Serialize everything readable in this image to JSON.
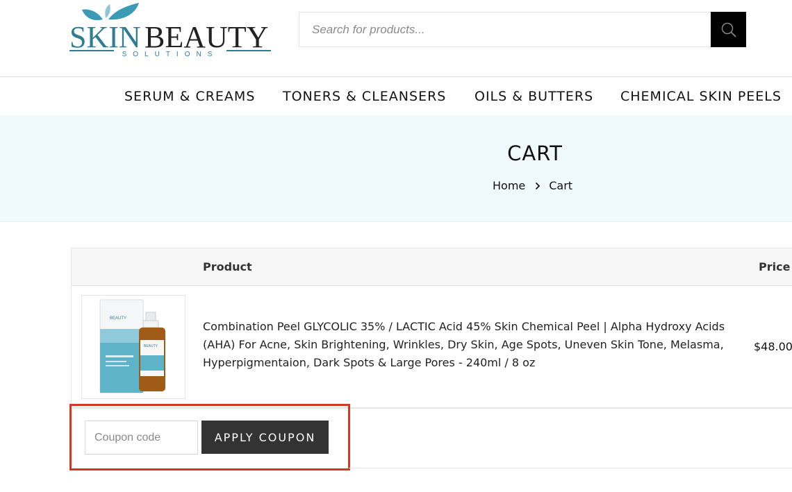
{
  "header": {
    "logo": {
      "word_skin": "SKIN",
      "word_beauty": "BEAUTY",
      "tagline": "SOLUTIONS",
      "colors": {
        "skin": "#2f7c95",
        "beauty": "#222222",
        "leaf": "#3a9bb5"
      }
    },
    "search": {
      "placeholder": "Search for products...",
      "button_icon": "search-icon"
    }
  },
  "nav": {
    "items": [
      {
        "label": "SERUM & CREAMS"
      },
      {
        "label": "TONERS & CLEANSERS"
      },
      {
        "label": "OILS & BUTTERS"
      },
      {
        "label": "CHEMICAL SKIN PEELS"
      }
    ]
  },
  "banner": {
    "title": "CART",
    "breadcrumb": {
      "home": "Home",
      "current": "Cart",
      "separator_icon": "chevron-right-icon"
    },
    "background": "#f0fafd"
  },
  "cart": {
    "columns": {
      "product": "Product",
      "price": "Price"
    },
    "items": [
      {
        "name": "Combination Peel GLYCOLIC 35% / LACTIC Acid 45% Skin Chemical Peel | Alpha Hydroxy Acids (AHA) For Acne, Skin Brightening, Wrinkles, Dry Skin, Age Spots, Uneven Skin Tone, Melasma, Hyperpigmentaion, Dark Spots & Large Pores - 240ml / 8 oz",
        "price": "$48.00",
        "thumb_box_label": "BEAUTY",
        "thumb_bottle_label": "BEAUTY"
      }
    ]
  },
  "coupon": {
    "placeholder": "Coupon code",
    "apply_label": "APPLY COUPON",
    "highlight_color": "#d13a1f"
  }
}
